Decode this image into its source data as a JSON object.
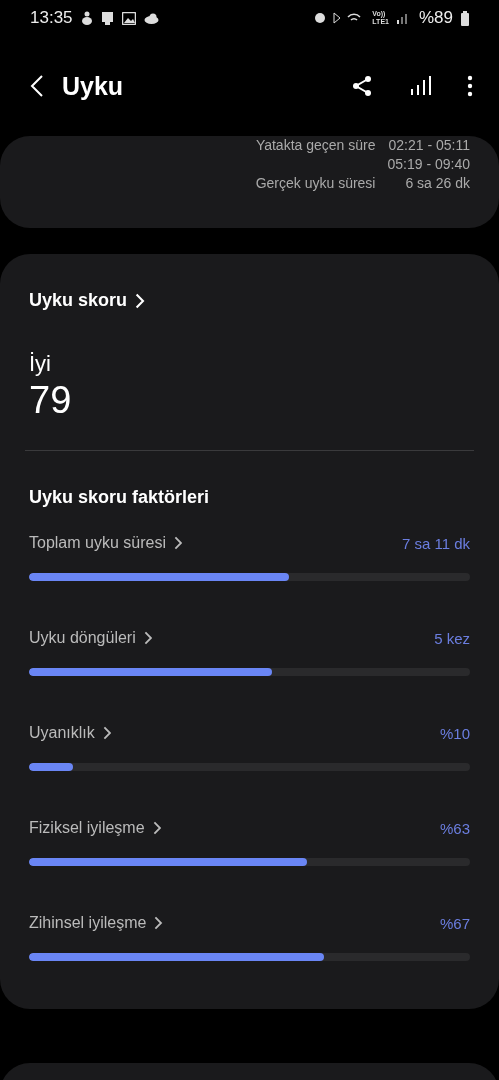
{
  "status_bar": {
    "time": "13:35",
    "network_top": "Vo))",
    "network_bottom": "LTE1",
    "battery": "%89"
  },
  "header": {
    "title": "Uyku"
  },
  "summary": {
    "rows": [
      {
        "label": "Yatakta geçen süre",
        "value": "02:21 - 05:11"
      },
      {
        "label": "",
        "value": "05:19 - 09:40"
      },
      {
        "label": "Gerçek uyku süresi",
        "value": "6 sa 26 dk"
      }
    ]
  },
  "score": {
    "link": "Uyku skoru",
    "rating": "İyi",
    "value": "79",
    "factors_title": "Uyku skoru faktörleri",
    "factors": [
      {
        "name": "Toplam uyku süresi",
        "reading": "7 sa 11 dk",
        "level": 0.59
      },
      {
        "name": "Uyku döngüleri",
        "reading": "5 kez",
        "level": 0.55
      },
      {
        "name": "Uyanıklık",
        "reading": "%10",
        "level": 0.1
      },
      {
        "name": "Fiziksel iyileşme",
        "reading": "%63",
        "level": 0.63
      },
      {
        "name": "Zihinsel iyileşme",
        "reading": "%67",
        "level": 0.67
      }
    ]
  }
}
